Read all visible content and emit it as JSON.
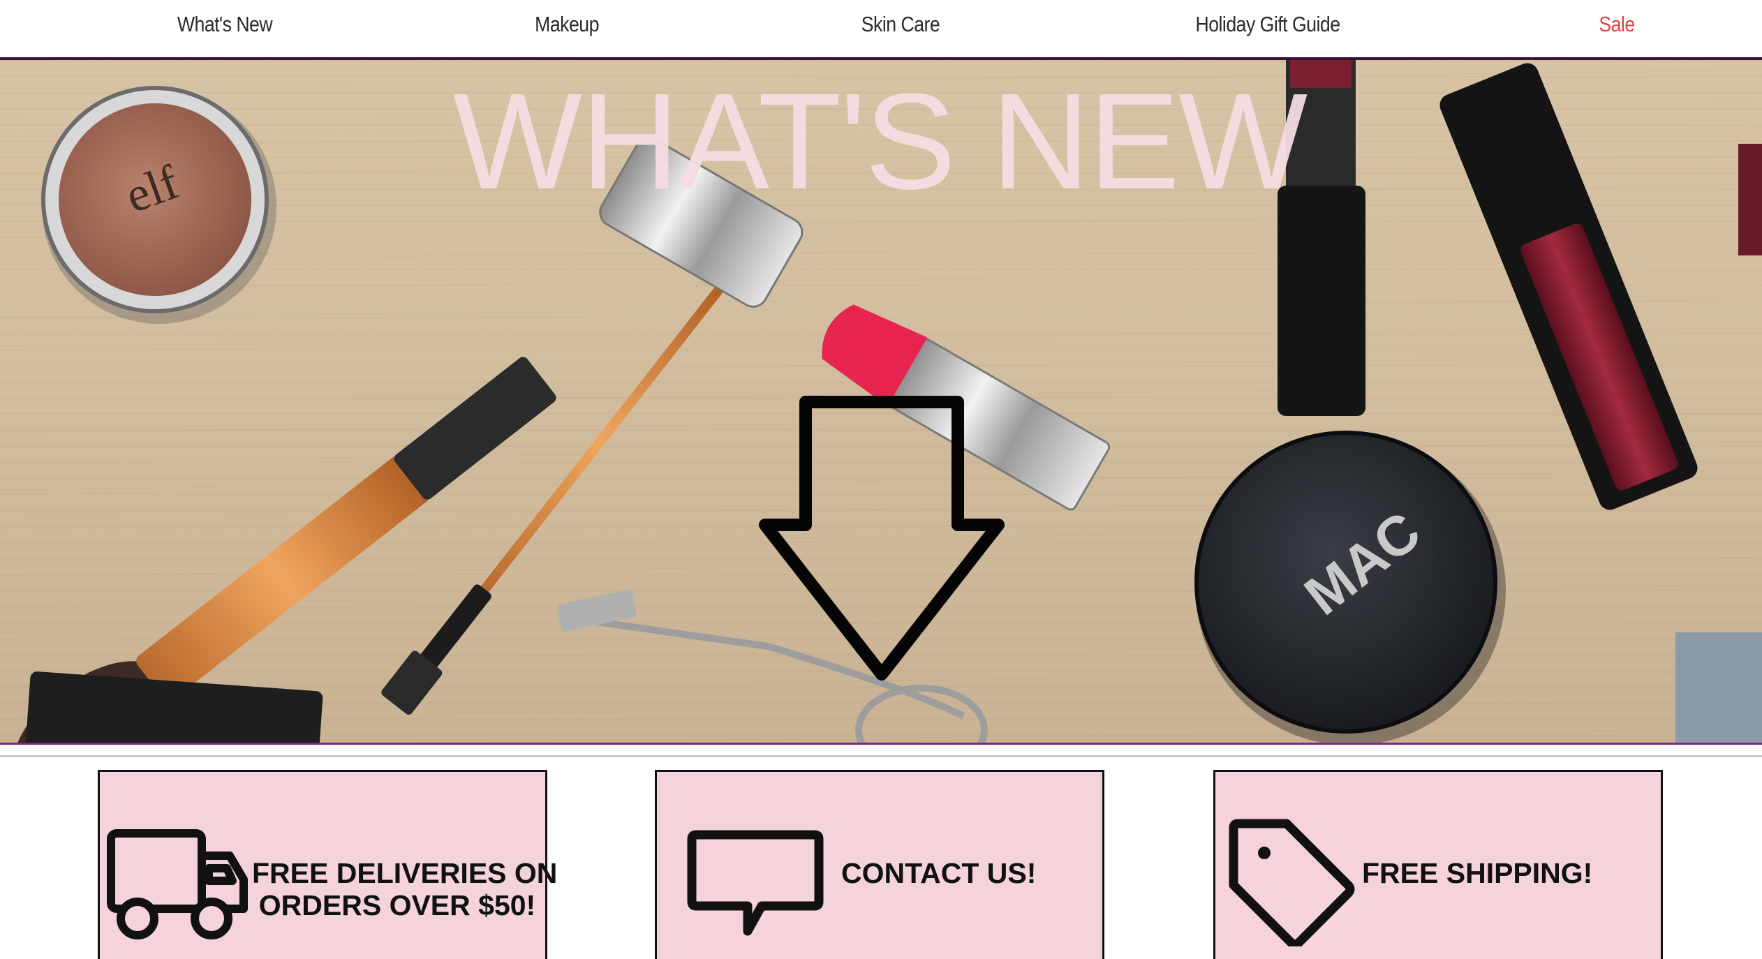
{
  "nav": {
    "items": [
      {
        "label": "What's New"
      },
      {
        "label": "Makeup"
      },
      {
        "label": "Skin Care"
      },
      {
        "label": "Holiday Gift Guide"
      },
      {
        "label": "Sale"
      }
    ],
    "sale_color": "#e0413f"
  },
  "hero": {
    "title": "WHAT'S NEW",
    "title_color": "#f6dde3",
    "scroll_icon": "down-arrow-icon"
  },
  "promos": [
    {
      "icon": "truck-icon",
      "line1": "FREE DELIVERIES ON",
      "line2": "ORDERS OVER $50!"
    },
    {
      "icon": "chat-bubble-icon",
      "line1": "CONTACT US!",
      "line2": ""
    },
    {
      "icon": "price-tag-icon",
      "line1": "FREE SHIPPING!",
      "line2": ""
    }
  ],
  "colors": {
    "accent_rule": "#3a1234",
    "card_background": "#f4d3db"
  }
}
